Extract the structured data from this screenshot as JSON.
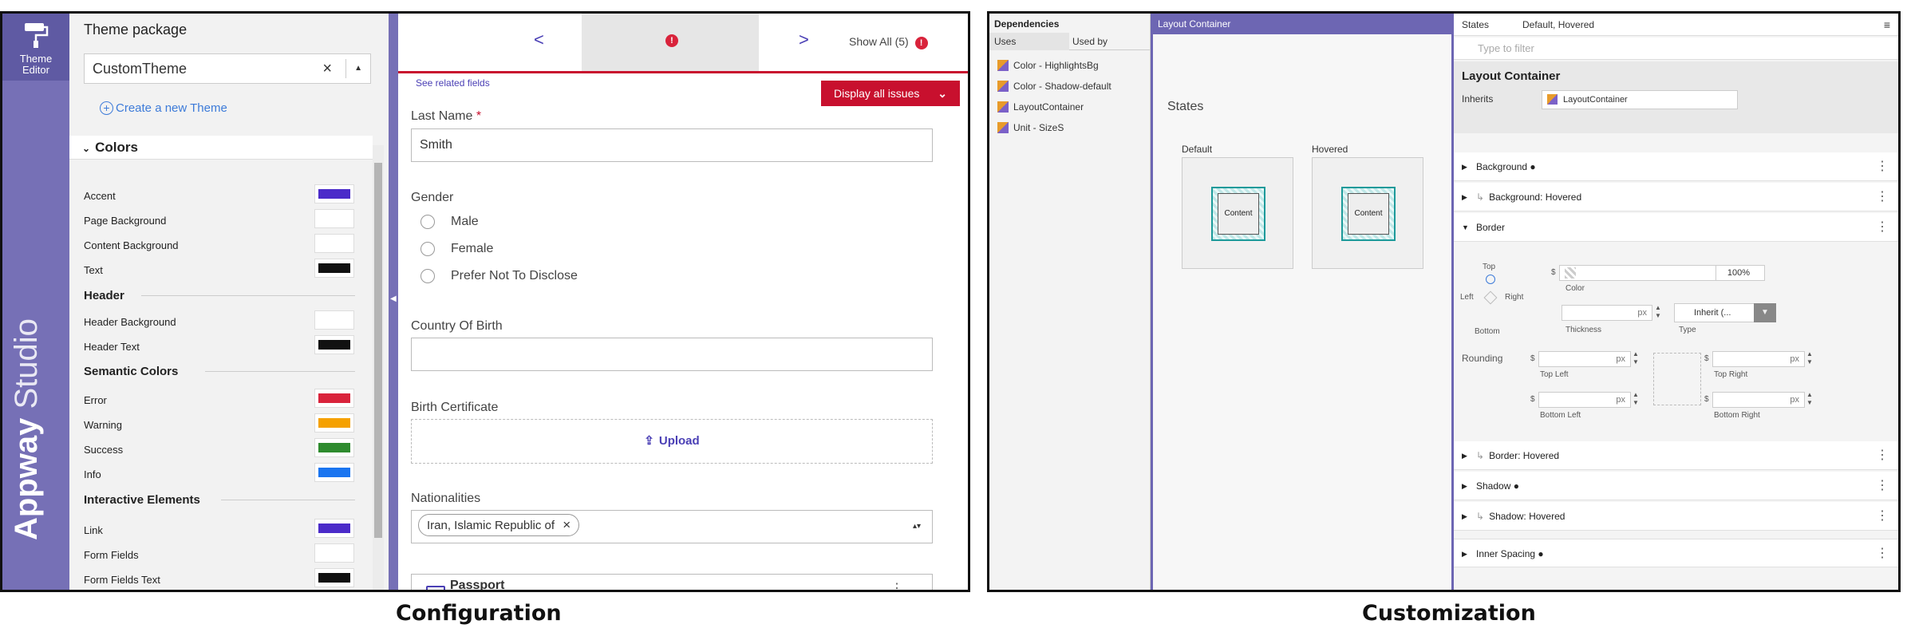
{
  "captions": {
    "left": "Configuration",
    "right": "Customization"
  },
  "config": {
    "rail": {
      "tool_label_1": "Theme",
      "tool_label_2": "Editor",
      "brand_bold": "Appway",
      "brand_light": "Studio",
      "tool_icon": "paint-roller-icon"
    },
    "theme_package": {
      "title": "Theme package",
      "selected": "CustomTheme",
      "clear": "×",
      "create_link": "Create a new Theme",
      "group": "Colors",
      "items": [
        {
          "label": "Accent",
          "color": "#4b2bc9"
        },
        {
          "label": "Page Background",
          "color": "#ffffff"
        },
        {
          "label": "Content Background",
          "color": "#ffffff"
        },
        {
          "label": "Text",
          "color": "#111111"
        },
        {
          "label": "Header Background",
          "color": "#ffffff"
        },
        {
          "label": "Header Text",
          "color": "#111111"
        },
        {
          "label": "Error",
          "color": "#d9233b"
        },
        {
          "label": "Warning",
          "color": "#f5a100"
        },
        {
          "label": "Success",
          "color": "#2e8b2e"
        },
        {
          "label": "Info",
          "color": "#1a75f0"
        },
        {
          "label": "Link",
          "color": "#4b2bc9"
        },
        {
          "label": "Form Fields",
          "color": "#ffffff"
        },
        {
          "label": "Form Fields Text",
          "color": "#111111"
        }
      ],
      "section_header": "Header",
      "section_semantic": "Semantic Colors",
      "section_interactive": "Interactive Elements"
    },
    "form": {
      "nav_prev": "<",
      "nav_next": ">",
      "show_all": "Show All (5)",
      "see_related": "See related fields",
      "display_issues": "Display all issues",
      "last_name_label": "Last Name",
      "required_mark": "*",
      "last_name_value": "Smith",
      "gender_label": "Gender",
      "gender_options": [
        "Male",
        "Female",
        "Prefer Not To Disclose"
      ],
      "country_label": "Country Of Birth",
      "country_value": "",
      "birth_cert_label": "Birth Certificate",
      "upload_label": "Upload",
      "nationalities_label": "Nationalities",
      "nationality_chip": "Iran, Islamic Republic of",
      "chip_remove": "×",
      "passport_label": "Passport"
    }
  },
  "custom": {
    "dependencies": {
      "title": "Dependencies",
      "tabs": [
        "Uses",
        "Used by"
      ],
      "items": [
        "Color - HighlightsBg",
        "Color - Shadow-default",
        "LayoutContainer",
        "Unit - SizeS"
      ]
    },
    "layout_container": {
      "header": "Layout Container",
      "states_title": "States",
      "states": [
        {
          "label": "Default",
          "content": "Content"
        },
        {
          "label": "Hovered",
          "content": "Content"
        }
      ]
    },
    "properties": {
      "states_label": "States",
      "states_value": "Default, Hovered",
      "filter_placeholder": "Type to filter",
      "title": "Layout Container",
      "inherits_label": "Inherits",
      "inherits_value": "LayoutContainer",
      "rows": [
        "Background",
        "Background: Hovered",
        "Border",
        "Border: Hovered",
        "Shadow",
        "Shadow: Hovered",
        "Inner Spacing"
      ],
      "border": {
        "top": "Top",
        "left": "Left",
        "right": "Right",
        "bottom": "Bottom",
        "color_label": "Color",
        "color_value": "100%",
        "thickness_label": "Thickness",
        "unit": "px",
        "type_label": "Type",
        "type_value": "Inherit (...",
        "rounding_label": "Rounding",
        "top_left": "Top Left",
        "top_right": "Top Right",
        "bottom_left": "Bottom Left",
        "bottom_right": "Bottom Right",
        "dollar": "$"
      }
    }
  }
}
